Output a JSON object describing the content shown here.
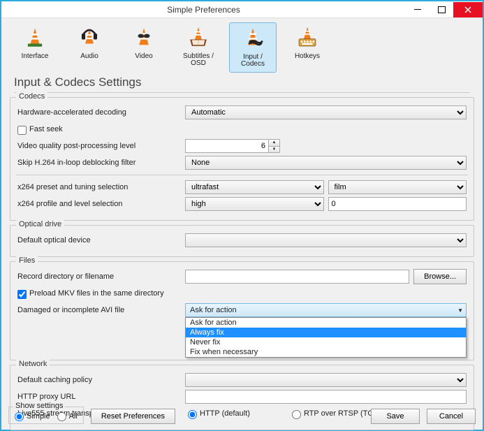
{
  "window": {
    "title": "Simple Preferences"
  },
  "categories": [
    {
      "id": "interface",
      "label": "Interface"
    },
    {
      "id": "audio",
      "label": "Audio"
    },
    {
      "id": "video",
      "label": "Video"
    },
    {
      "id": "subtitles",
      "label": "Subtitles / OSD"
    },
    {
      "id": "inputcodecs",
      "label": "Input / Codecs"
    },
    {
      "id": "hotkeys",
      "label": "Hotkeys"
    }
  ],
  "selected_category": "inputcodecs",
  "page_heading": "Input & Codecs Settings",
  "groups": {
    "codecs": {
      "legend": "Codecs",
      "hw_decoding_label": "Hardware-accelerated decoding",
      "hw_decoding_value": "Automatic",
      "fast_seek_label": "Fast seek",
      "fast_seek_checked": false,
      "pp_level_label": "Video quality post-processing level",
      "pp_level_value": "6",
      "skip_loop_label": "Skip H.264 in-loop deblocking filter",
      "skip_loop_value": "None",
      "x264_preset_label": "x264 preset and tuning selection",
      "x264_preset_value": "ultrafast",
      "x264_tuning_value": "film",
      "x264_profile_label": "x264 profile and level selection",
      "x264_profile_value": "high",
      "x264_level_value": "0"
    },
    "optical": {
      "legend": "Optical drive",
      "default_device_label": "Default optical device",
      "default_device_value": ""
    },
    "files": {
      "legend": "Files",
      "record_dir_label": "Record directory or filename",
      "record_dir_value": "",
      "browse_label": "Browse...",
      "preload_mkv_label": "Preload MKV files in the same directory",
      "preload_mkv_checked": true,
      "avi_fix_label": "Damaged or incomplete AVI file",
      "avi_fix_value": "Ask for action",
      "avi_fix_options": [
        "Ask for action",
        "Always fix",
        "Never fix",
        "Fix when necessary"
      ],
      "avi_fix_highlight_index": 1
    },
    "network": {
      "legend": "Network",
      "caching_label": "Default caching policy",
      "caching_value": "",
      "proxy_label": "HTTP proxy URL",
      "proxy_value": "",
      "live555_label": "Live555 stream transport",
      "live555_http": "HTTP (default)",
      "live555_rtp": "RTP over RTSP (TCP)",
      "live555_selected": "http"
    }
  },
  "footer": {
    "show_settings_legend": "Show settings",
    "simple_label": "Simple",
    "all_label": "All",
    "selected_mode": "simple",
    "reset_label": "Reset Preferences",
    "save_label": "Save",
    "cancel_label": "Cancel"
  }
}
